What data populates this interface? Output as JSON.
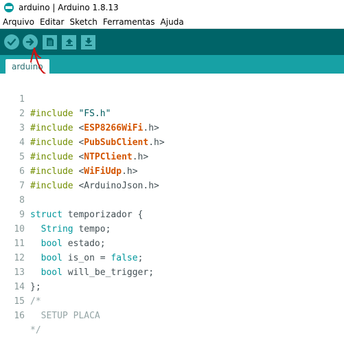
{
  "window": {
    "title": "arduino | Arduino 1.8.13"
  },
  "menu": [
    "Arquivo",
    "Editar",
    "Sketch",
    "Ferramentas",
    "Ajuda"
  ],
  "toolbar": {
    "buttons": [
      "verify-icon",
      "upload-icon",
      "new-icon",
      "open-icon",
      "save-icon"
    ],
    "colors": {
      "bar": "#006468",
      "button": "#4db7bb"
    }
  },
  "tab": {
    "label": "arduino"
  },
  "code": {
    "line_numbers": [
      "1",
      "2",
      "3",
      "4",
      "5",
      "6",
      "7",
      "8",
      "9",
      "10",
      "11",
      "12",
      "13",
      "14",
      "15",
      "16"
    ],
    "l1": {
      "kw": "#include",
      "str": "\"FS.h\""
    },
    "l2": {
      "kw": "#include",
      "open": "<",
      "lib": "ESP8266WiFi",
      "rest": ".h>"
    },
    "l3": {
      "kw": "#include",
      "open": "<",
      "lib": "PubSubClient",
      "rest": ".h>"
    },
    "l4": {
      "kw": "#include",
      "open": "<",
      "lib": "NTPClient",
      "rest": ".h>"
    },
    "l5": {
      "kw": "#include",
      "open": "<",
      "lib": "WiFiUdp",
      "rest": ".h>"
    },
    "l6": {
      "kw": "#include",
      "rest": "<ArduinoJson.h>"
    },
    "l8": {
      "kw": "struct",
      "rest": " temporizador {"
    },
    "l9": {
      "type": "String",
      "rest": " tempo;"
    },
    "l10": {
      "type": "bool",
      "rest": " estado;"
    },
    "l11": {
      "type": "bool",
      "mid": " is_on = ",
      "val": "false",
      "rest": ";"
    },
    "l12": {
      "type": "bool",
      "rest": " will_be_trigger;"
    },
    "l13": {
      "text": "};"
    },
    "l14": {
      "text": "/*"
    },
    "l15": {
      "text": "  SETUP PLACA"
    },
    "l16": {
      "text": "*/"
    }
  }
}
